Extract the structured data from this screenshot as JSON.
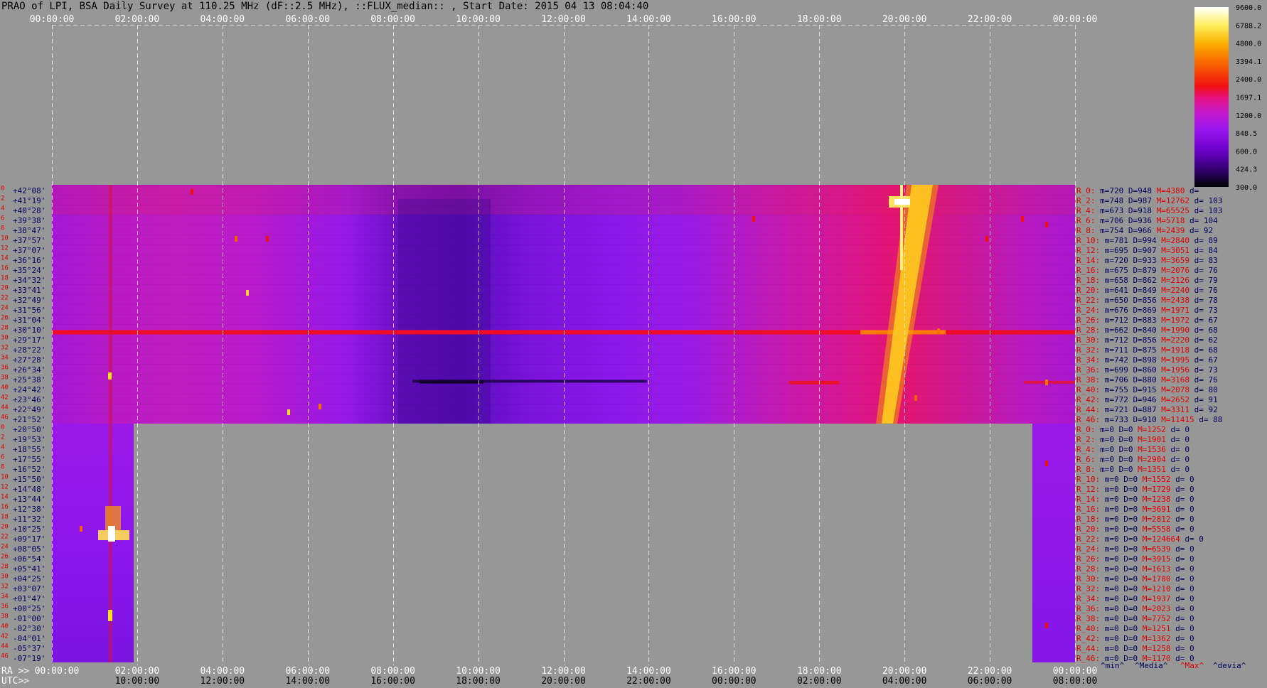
{
  "title": "PRAO of LPI, BSA Daily Survey at 110.25 MHz (dF::2.5 MHz), ::FLUX_median:: , Start Date: 2015 04 13 08:04:40",
  "chart_data": {
    "type": "heatmap",
    "top_time_ticks": [
      "00:00:00",
      "02:00:00",
      "04:00:00",
      "06:00:00",
      "08:00:00",
      "10:00:00",
      "12:00:00",
      "14:00:00",
      "16:00:00",
      "18:00:00",
      "20:00:00",
      "22:00:00",
      "00:00:00"
    ],
    "ra_axis_label": "RA >>",
    "ra_ticks": [
      "00:00:00",
      "02:00:00",
      "04:00:00",
      "06:00:00",
      "08:00:00",
      "10:00:00",
      "12:00:00",
      "14:00:00",
      "16:00:00",
      "18:00:00",
      "20:00:00",
      "22:00:00",
      "00:00:00"
    ],
    "utc_axis_label": "UTC>>",
    "utc_ticks": [
      "10:00:00",
      "12:00:00",
      "14:00:00",
      "16:00:00",
      "18:00:00",
      "20:00:00",
      "22:00:00",
      "00:00:00",
      "02:00:00",
      "04:00:00",
      "06:00:00",
      "08:00:00"
    ],
    "colorbar_ticks": [
      "9600.0",
      "6788.2",
      "4800.0",
      "3394.1",
      "2400.0",
      "1697.1",
      "1200.0",
      "848.5",
      "600.0",
      "424.3",
      "300.0"
    ],
    "upper_block": {
      "dec_labels": [
        "+42°08'",
        "+41°19'",
        "+40°28'",
        "+39°38'",
        "+38°47'",
        "+37°57'",
        "+37°07'",
        "+36°16'",
        "+35°24'",
        "+34°32'",
        "+33°41'",
        "+32°49'",
        "+31°56'",
        "+31°04'",
        "+30°10'",
        "+29°17'",
        "+28°22'",
        "+27°28'",
        "+26°34'",
        "+25°38'",
        "+24°42'",
        "+23°46'",
        "+22°49'",
        "+21°52'"
      ],
      "beam_numbers": [
        "0",
        "2",
        "4",
        "6",
        "8",
        "10",
        "12",
        "14",
        "16",
        "18",
        "20",
        "22",
        "24",
        "26",
        "28",
        "30",
        "32",
        "34",
        "36",
        "38",
        "40",
        "42",
        "44",
        "46"
      ]
    },
    "lower_block": {
      "dec_labels": [
        "+20°50'",
        "+19°53'",
        "+18°55'",
        "+17°55'",
        "+16°52'",
        "+15°50'",
        "+14°48'",
        "+13°44'",
        "+12°38'",
        "+11°32'",
        "+10°25'",
        "+09°17'",
        "+08°05'",
        "+06°54'",
        "+05°41'",
        "+04°25'",
        "+03°07'",
        "+01°47'",
        "+00°25'",
        "-01°00'",
        "-02°30'",
        "-04°01'",
        "-05°37'",
        "-07°19'"
      ],
      "beam_numbers": [
        "0",
        "2",
        "4",
        "6",
        "8",
        "10",
        "12",
        "14",
        "16",
        "18",
        "20",
        "22",
        "24",
        "26",
        "28",
        "30",
        "32",
        "34",
        "36",
        "38",
        "40",
        "42",
        "44",
        "46"
      ]
    },
    "beam_stats_upper": [
      {
        "beam": "R_0:",
        "min": "720",
        "median": "948",
        "max": "4380",
        "dev": ""
      },
      {
        "beam": "R_2:",
        "min": "748",
        "median": "987",
        "max": "12762",
        "dev": "103"
      },
      {
        "beam": "R_4:",
        "min": "673",
        "median": "918",
        "max": "65525",
        "dev": "103"
      },
      {
        "beam": "R_6:",
        "min": "706",
        "median": "936",
        "max": "5718",
        "dev": "104"
      },
      {
        "beam": "R_8:",
        "min": "754",
        "median": "966",
        "max": "2439",
        "dev": "92"
      },
      {
        "beam": "R_10:",
        "min": "781",
        "median": "994",
        "max": "2840",
        "dev": "89"
      },
      {
        "beam": "R_12:",
        "min": "695",
        "median": "907",
        "max": "3051",
        "dev": "84"
      },
      {
        "beam": "R_14:",
        "min": "720",
        "median": "933",
        "max": "3659",
        "dev": "83"
      },
      {
        "beam": "R_16:",
        "min": "675",
        "median": "879",
        "max": "2076",
        "dev": "76"
      },
      {
        "beam": "R_18:",
        "min": "658",
        "median": "862",
        "max": "2126",
        "dev": "79"
      },
      {
        "beam": "R_20:",
        "min": "641",
        "median": "849",
        "max": "2240",
        "dev": "76"
      },
      {
        "beam": "R_22:",
        "min": "650",
        "median": "856",
        "max": "2438",
        "dev": "78"
      },
      {
        "beam": "R_24:",
        "min": "676",
        "median": "869",
        "max": "1971",
        "dev": "73"
      },
      {
        "beam": "R_26:",
        "min": "712",
        "median": "883",
        "max": "1972",
        "dev": "67"
      },
      {
        "beam": "R_28:",
        "min": "662",
        "median": "840",
        "max": "1990",
        "dev": "68"
      },
      {
        "beam": "R_30:",
        "min": "712",
        "median": "856",
        "max": "2220",
        "dev": "62"
      },
      {
        "beam": "R_32:",
        "min": "711",
        "median": "875",
        "max": "1918",
        "dev": "68"
      },
      {
        "beam": "R_34:",
        "min": "742",
        "median": "898",
        "max": "1995",
        "dev": "67"
      },
      {
        "beam": "R_36:",
        "min": "699",
        "median": "860",
        "max": "1956",
        "dev": "73"
      },
      {
        "beam": "R_38:",
        "min": "706",
        "median": "880",
        "max": "3168",
        "dev": "76"
      },
      {
        "beam": "R_40:",
        "min": "755",
        "median": "915",
        "max": "2078",
        "dev": "80"
      },
      {
        "beam": "R_42:",
        "min": "772",
        "median": "946",
        "max": "2652",
        "dev": "91"
      },
      {
        "beam": "R_44:",
        "min": "721",
        "median": "887",
        "max": "3311",
        "dev": "92"
      },
      {
        "beam": "R_46:",
        "min": "733",
        "median": "910",
        "max": "11415",
        "dev": "88"
      }
    ],
    "beam_stats_lower": [
      {
        "beam": "R_0:",
        "min": "0",
        "median": "0",
        "max": "1252",
        "dev": "0"
      },
      {
        "beam": "R_2:",
        "min": "0",
        "median": "0",
        "max": "1901",
        "dev": "0"
      },
      {
        "beam": "R_4:",
        "min": "0",
        "median": "0",
        "max": "1536",
        "dev": "0"
      },
      {
        "beam": "R_6:",
        "min": "0",
        "median": "0",
        "max": "2904",
        "dev": "0"
      },
      {
        "beam": "R_8:",
        "min": "0",
        "median": "0",
        "max": "1351",
        "dev": "0"
      },
      {
        "beam": "R_10:",
        "min": "0",
        "median": "0",
        "max": "1552",
        "dev": "0"
      },
      {
        "beam": "R_12:",
        "min": "0",
        "median": "0",
        "max": "1729",
        "dev": "0"
      },
      {
        "beam": "R_14:",
        "min": "0",
        "median": "0",
        "max": "1238",
        "dev": "0"
      },
      {
        "beam": "R_16:",
        "min": "0",
        "median": "0",
        "max": "3691",
        "dev": "0"
      },
      {
        "beam": "R_18:",
        "min": "0",
        "median": "0",
        "max": "2812",
        "dev": "0"
      },
      {
        "beam": "R_20:",
        "min": "0",
        "median": "0",
        "max": "5558",
        "dev": "0"
      },
      {
        "beam": "R_22:",
        "min": "0",
        "median": "0",
        "max": "124664",
        "dev": "0"
      },
      {
        "beam": "R_24:",
        "min": "0",
        "median": "0",
        "max": "6539",
        "dev": "0"
      },
      {
        "beam": "R_26:",
        "min": "0",
        "median": "0",
        "max": "3915",
        "dev": "0"
      },
      {
        "beam": "R_28:",
        "min": "0",
        "median": "0",
        "max": "1613",
        "dev": "0"
      },
      {
        "beam": "R_30:",
        "min": "0",
        "median": "0",
        "max": "1780",
        "dev": "0"
      },
      {
        "beam": "R_32:",
        "min": "0",
        "median": "0",
        "max": "1210",
        "dev": "0"
      },
      {
        "beam": "R_34:",
        "min": "0",
        "median": "0",
        "max": "1937",
        "dev": "0"
      },
      {
        "beam": "R_36:",
        "min": "0",
        "median": "0",
        "max": "2023",
        "dev": "0"
      },
      {
        "beam": "R_38:",
        "min": "0",
        "median": "0",
        "max": "7752",
        "dev": "0"
      },
      {
        "beam": "R_40:",
        "min": "0",
        "median": "0",
        "max": "1251",
        "dev": "0"
      },
      {
        "beam": "R_42:",
        "min": "0",
        "median": "0",
        "max": "1362",
        "dev": "0"
      },
      {
        "beam": "R_44:",
        "min": "0",
        "median": "0",
        "max": "1258",
        "dev": "0"
      },
      {
        "beam": "R_46:",
        "min": "0",
        "median": "0",
        "max": "1170",
        "dev": "0"
      }
    ],
    "stats_footer": [
      "^min^",
      "^Media^",
      "^Max^",
      "^devia^"
    ],
    "colors": {
      "background": "#979797",
      "label_red": "#e00000",
      "label_navy": "#00005a",
      "colormap": [
        "#000000",
        "#2a0060",
        "#6a00c8",
        "#9a16f0",
        "#c81ac8",
        "#e8107a",
        "#f01010",
        "#f86000",
        "#fcb000",
        "#fff060",
        "#ffffff"
      ]
    }
  }
}
